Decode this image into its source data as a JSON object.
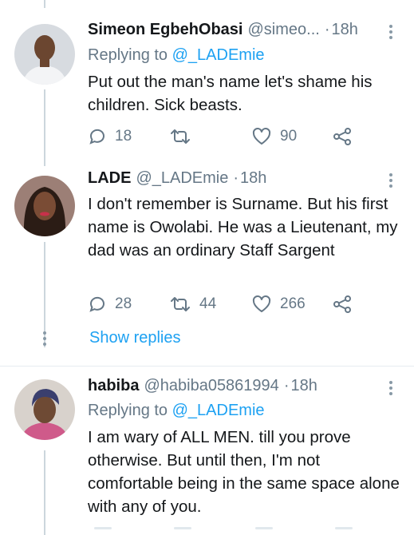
{
  "tweets": [
    {
      "display_name": "Simeon EgbehObasi",
      "handle": "@simeo...",
      "separator": "·",
      "time": "18h",
      "replying_prefix": "Replying to",
      "replying_to": "@_LADEmie",
      "body": "Put out the man's name let's shame his children. Sick beasts.",
      "replies": "18",
      "retweets": "",
      "likes": "90",
      "avatar_colors": {
        "bg": "#d7dbe0",
        "skin": "#6b4630",
        "shirt": "#f3f4f6"
      }
    },
    {
      "display_name": "LADE",
      "handle": "@_LADEmie",
      "separator": "·",
      "time": "18h",
      "body": "I don't remember is Surname. But his first name is Owolabi. He was a Lieutenant, my dad was an ordinary Staff Sargent",
      "replies": "28",
      "retweets": "44",
      "likes": "266",
      "show_replies": "Show replies",
      "avatar_colors": {
        "bg": "#9c7f76",
        "skin": "#7a4c35",
        "hair": "#2b1c15",
        "lips": "#c8314a"
      }
    },
    {
      "display_name": "habiba",
      "handle": "@habiba05861994",
      "separator": "·",
      "time": "18h",
      "replying_prefix": "Replying to",
      "replying_to": "@_LADEmie",
      "body": "I am wary of ALL MEN. till you prove otherwise. But until then, I'm not comfortable being in the same space alone with any of you.",
      "avatar_colors": {
        "bg": "#d8d2cc",
        "skin": "#6e4a34",
        "headwrap": "#3a3f6e",
        "top": "#cf5a8a"
      }
    }
  ],
  "icons": {
    "reply": "reply-icon",
    "retweet": "retweet-icon",
    "like": "heart-icon",
    "share": "share-icon",
    "more": "more-vertical-icon"
  },
  "colors": {
    "link": "#1da1f2",
    "secondary": "#657786",
    "text": "#14171a",
    "thread_line": "#ccd6dd",
    "divider": "#e6ecf0"
  }
}
